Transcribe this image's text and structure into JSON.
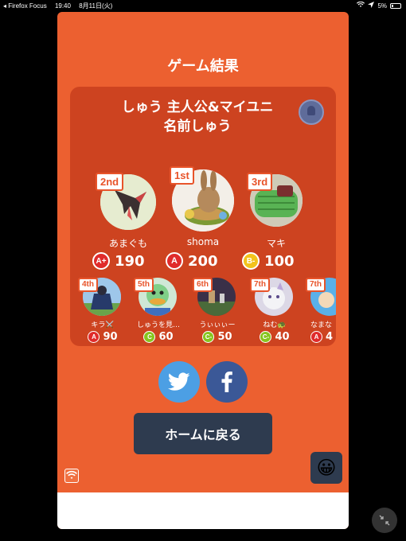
{
  "status_bar": {
    "app": "◂ Firefox Focus",
    "time": "19:40",
    "date": "8月11日(火)",
    "battery": "5%"
  },
  "title": "ゲーム結果",
  "room": {
    "name_line1": "しゅう 主人公&マイユニ",
    "name_line2": "名前しゅう"
  },
  "top_players": [
    {
      "rank": "2nd",
      "name": "あまぐも",
      "grade": "A+",
      "grade_color": "#e02b2b",
      "score": "190"
    },
    {
      "rank": "1st",
      "name": "shoma",
      "grade": "A",
      "grade_color": "#e02b2b",
      "score": "200"
    },
    {
      "rank": "3rd",
      "name": "マキ",
      "grade": "B-",
      "grade_color": "#f2c31c",
      "score": "100"
    }
  ],
  "other_players": [
    {
      "rank": "4th",
      "name": "キラ⚔️",
      "grade": "A",
      "grade_color": "#e02b2b",
      "score": "90"
    },
    {
      "rank": "5th",
      "name": "しゅうを見…",
      "grade": "C",
      "grade_color": "#86c51f",
      "score": "60"
    },
    {
      "rank": "6th",
      "name": "うぃぃぃー",
      "grade": "C-",
      "grade_color": "#86c51f",
      "score": "50"
    },
    {
      "rank": "7th",
      "name": "ねむ🐢",
      "grade": "C-",
      "grade_color": "#86c51f",
      "score": "40"
    },
    {
      "rank": "7th",
      "name": "なまな",
      "grade": "A",
      "grade_color": "#e02b2b",
      "score": "4"
    }
  ],
  "share": {
    "twitter_icon": "twitter-bird-icon",
    "facebook_icon": "facebook-f-icon"
  },
  "home_button": "ホームに戻る",
  "emoji": "😀",
  "colors": {
    "card": "#ec6030",
    "panel": "#cd4320",
    "rank_badge": "#e8542a",
    "button_dark": "#2e3b4f"
  }
}
